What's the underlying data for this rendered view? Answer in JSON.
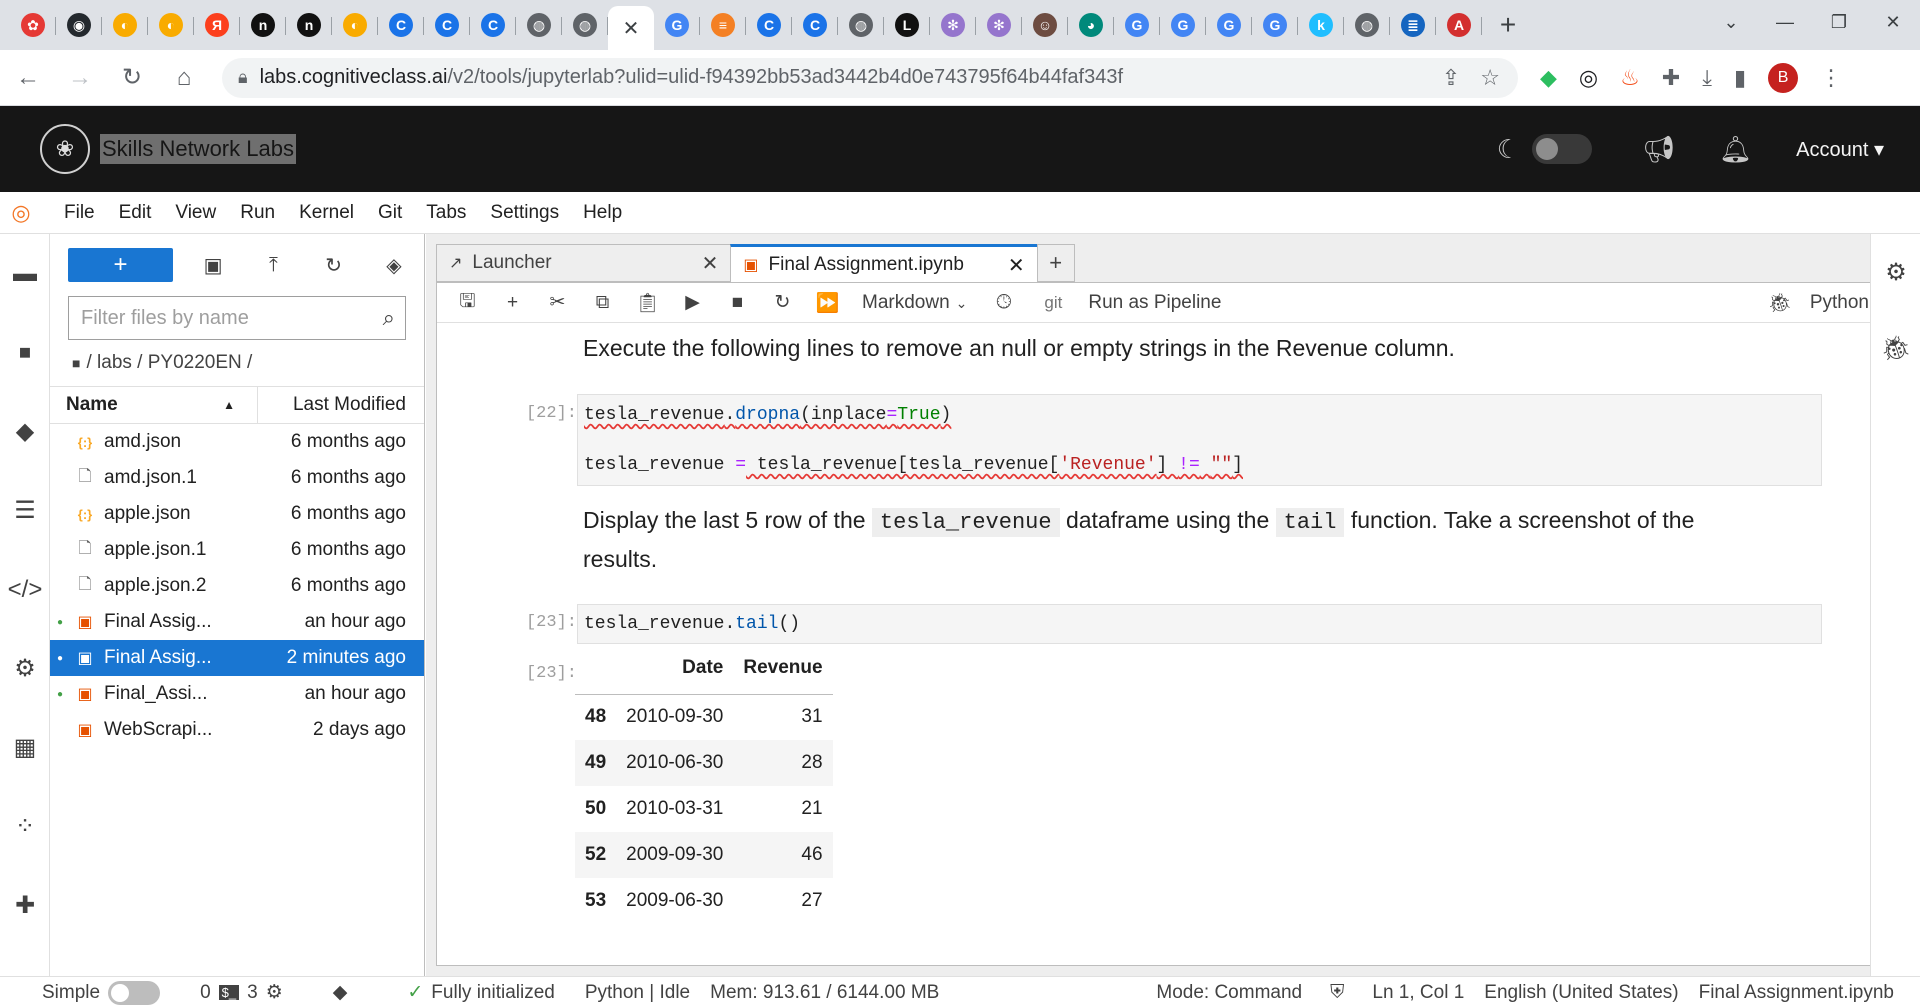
{
  "browser": {
    "tabs": [
      {
        "icon": "pinwheel",
        "color": "#e53935",
        "label": "✿"
      },
      {
        "icon": "github",
        "color": "#24292e",
        "label": "◉"
      },
      {
        "icon": "colab",
        "color": "#f9ab00",
        "label": "◐"
      },
      {
        "icon": "colab",
        "color": "#f9ab00",
        "label": "◐"
      },
      {
        "icon": "yandex",
        "color": "#fc3f1d",
        "label": "Я"
      },
      {
        "icon": "dark-n",
        "color": "#111111",
        "label": "n"
      },
      {
        "icon": "dark-n",
        "color": "#111111",
        "label": "n"
      },
      {
        "icon": "colab",
        "color": "#f9ab00",
        "label": "◐"
      },
      {
        "icon": "c-blue",
        "color": "#1a73e8",
        "label": "C"
      },
      {
        "icon": "c-blue",
        "color": "#1a73e8",
        "label": "C"
      },
      {
        "icon": "c-blue",
        "color": "#1a73e8",
        "label": "C"
      },
      {
        "icon": "globe",
        "color": "#5f6368",
        "label": "◍"
      },
      {
        "icon": "globe",
        "color": "#5f6368",
        "label": "◍"
      },
      {
        "icon": "close",
        "color": "#3c4043",
        "label": "✕",
        "active": true
      },
      {
        "icon": "google",
        "color": "#4285f4",
        "label": "G"
      },
      {
        "icon": "stackoverflow",
        "color": "#f48024",
        "label": "≡"
      },
      {
        "icon": "c-blue",
        "color": "#1a73e8",
        "label": "C"
      },
      {
        "icon": "c-blue",
        "color": "#1a73e8",
        "label": "C"
      },
      {
        "icon": "globe",
        "color": "#5f6368",
        "label": "◍"
      },
      {
        "icon": "letter-l",
        "color": "#111111",
        "label": "L"
      },
      {
        "icon": "flower",
        "color": "#9575cd",
        "label": "✻"
      },
      {
        "icon": "flower",
        "color": "#9575cd",
        "label": "✻"
      },
      {
        "icon": "face",
        "color": "#6d4c41",
        "label": "☺"
      },
      {
        "icon": "teal-circle",
        "color": "#00897b",
        "label": "◕"
      },
      {
        "icon": "google",
        "color": "#4285f4",
        "label": "G"
      },
      {
        "icon": "google",
        "color": "#4285f4",
        "label": "G"
      },
      {
        "icon": "google",
        "color": "#4285f4",
        "label": "G"
      },
      {
        "icon": "google",
        "color": "#4285f4",
        "label": "G"
      },
      {
        "icon": "kaggle",
        "color": "#20beff",
        "label": "k"
      },
      {
        "icon": "globe",
        "color": "#5f6368",
        "label": "◍"
      },
      {
        "icon": "stack-blue",
        "color": "#1565c0",
        "label": "≣"
      },
      {
        "icon": "red-circle",
        "color": "#d32f2f",
        "label": "A"
      }
    ],
    "url_host": "labs.cognitiveclass.ai",
    "url_path": "/v2/tools/jupyterlab?ulid=ulid-f94392bb53ad3442b4d0e743795f64b44faf343f",
    "profile_initial": "B"
  },
  "header": {
    "title": "Skills Network Labs",
    "account_label": "Account"
  },
  "menu": [
    "File",
    "Edit",
    "View",
    "Run",
    "Kernel",
    "Git",
    "Tabs",
    "Settings",
    "Help"
  ],
  "filebrowser": {
    "new_label": "+",
    "filter_placeholder": "Filter files by name",
    "breadcrumb": "/ labs / PY0220EN /",
    "col_name": "Name",
    "col_modified": "Last Modified",
    "files": [
      {
        "type": "json",
        "name": "amd.json",
        "modified": "6 months ago",
        "running": false,
        "selected": false
      },
      {
        "type": "file",
        "name": "amd.json.1",
        "modified": "6 months ago",
        "running": false,
        "selected": false
      },
      {
        "type": "json",
        "name": "apple.json",
        "modified": "6 months ago",
        "running": false,
        "selected": false
      },
      {
        "type": "file",
        "name": "apple.json.1",
        "modified": "6 months ago",
        "running": false,
        "selected": false
      },
      {
        "type": "file",
        "name": "apple.json.2",
        "modified": "6 months ago",
        "running": false,
        "selected": false
      },
      {
        "type": "notebook",
        "name": "Final Assig...",
        "modified": "an hour ago",
        "running": true,
        "selected": false
      },
      {
        "type": "notebook",
        "name": "Final Assig...",
        "modified": "2 minutes ago",
        "running": true,
        "selected": true
      },
      {
        "type": "notebook",
        "name": "Final_Assi...",
        "modified": "an hour ago",
        "running": true,
        "selected": false
      },
      {
        "type": "notebook",
        "name": "WebScrapi...",
        "modified": "2 days ago",
        "running": false,
        "selected": false
      }
    ]
  },
  "tabs": {
    "launcher": "Launcher",
    "notebook": "Final Assignment.ipynb"
  },
  "nbtoolbar": {
    "cell_type": "Markdown",
    "git": "git",
    "pipeline": "Run as Pipeline",
    "kernel": "Python"
  },
  "notebook": {
    "md1": "Execute the following lines to remove an null or empty strings in the Revenue column.",
    "prompt22": "[22]:",
    "code22_line1": {
      "a": "tesla_revenue",
      "b": ".",
      "c": "dropna",
      "d": "(inplace",
      "e": "=",
      "f": "True",
      "g": ")"
    },
    "code22_line2": {
      "a": "tesla_revenue ",
      "b": "=",
      "c": " tesla_revenue[tesla_revenue[",
      "d": "'Revenue'",
      "e": "] ",
      "f": "!=",
      "g": " ",
      "h": "\"\"",
      "i": "]"
    },
    "md2_pre": "Display the last 5 row of the ",
    "md2_code1": "tesla_revenue",
    "md2_mid": " dataframe using the ",
    "md2_code2": "tail",
    "md2_post": " function. Take a screenshot of the",
    "md2_line2": "results.",
    "prompt23": "[23]:",
    "code23": {
      "a": "tesla_revenue",
      "b": ".",
      "c": "tail",
      "d": "()"
    },
    "out_prompt": "[23]:",
    "table": {
      "columns": [
        "Date",
        "Revenue"
      ],
      "rows": [
        {
          "idx": "48",
          "date": "2010-09-30",
          "rev": "31"
        },
        {
          "idx": "49",
          "date": "2010-06-30",
          "rev": "28"
        },
        {
          "idx": "50",
          "date": "2010-03-31",
          "rev": "21"
        },
        {
          "idx": "52",
          "date": "2009-09-30",
          "rev": "46"
        },
        {
          "idx": "53",
          "date": "2009-06-30",
          "rev": "27"
        }
      ]
    }
  },
  "status": {
    "simple": "Simple",
    "terminals": "0",
    "kernels": "3",
    "init": "Fully initialized",
    "kernel_state": "Python | Idle",
    "mem": "Mem: 913.61 / 6144.00 MB",
    "mode": "Mode: Command",
    "position": "Ln 1, Col 1",
    "language": "English (United States)",
    "file": "Final Assignment.ipynb"
  }
}
